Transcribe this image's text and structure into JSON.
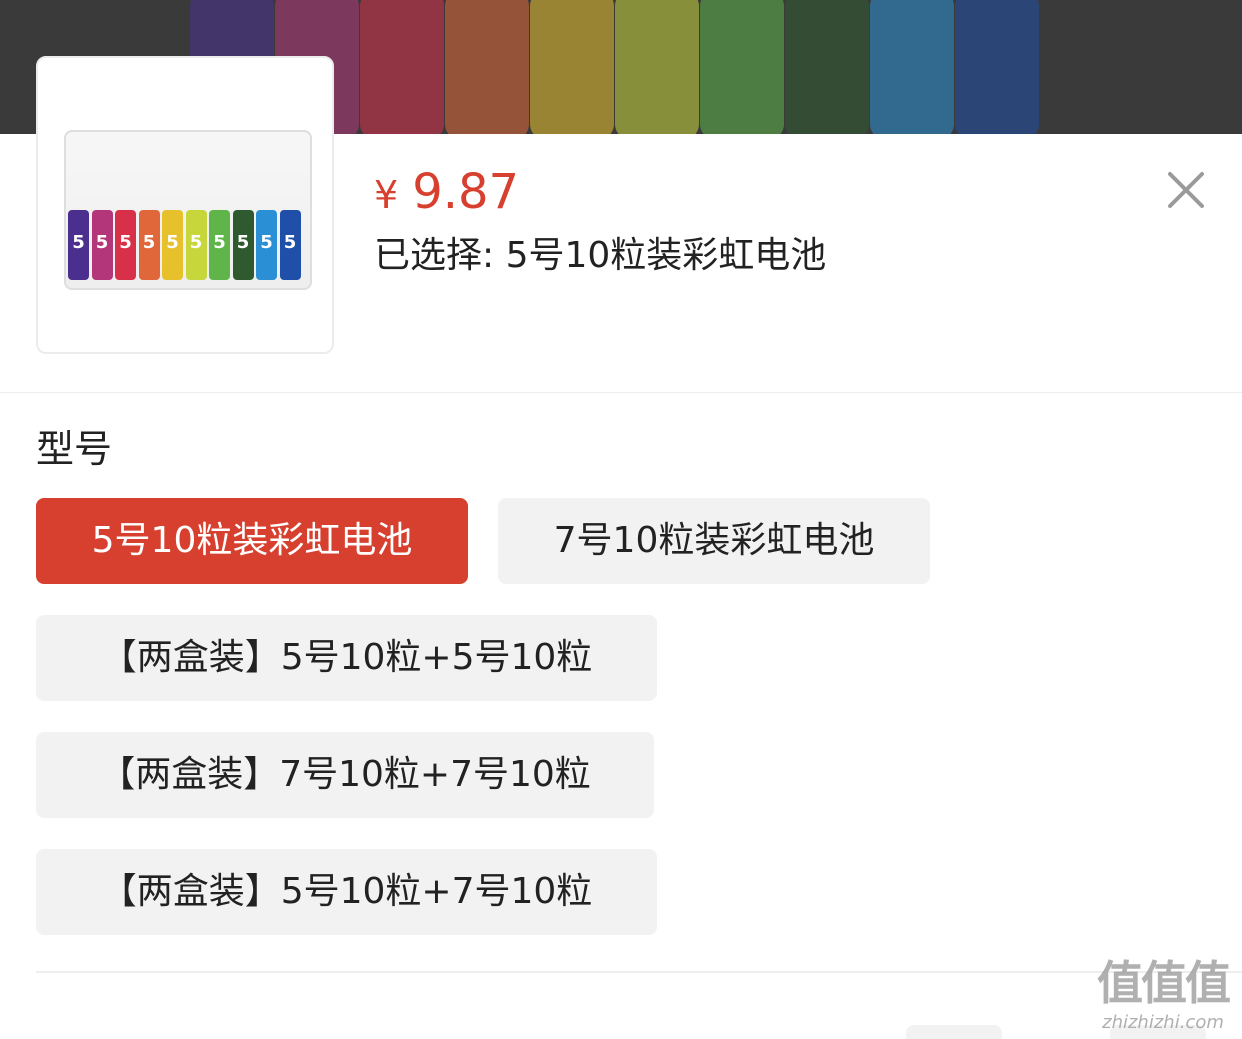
{
  "colors": {
    "accent": "#d7402f",
    "option_bg": "#f2f2f2",
    "backdrop": "#3a3a3a",
    "battery_colors": [
      "#4b2f8f",
      "#b4367a",
      "#d9304a",
      "#e0673a",
      "#e6c12c",
      "#c7d63a",
      "#5fb54a",
      "#2f5a2f",
      "#2b8fd6",
      "#1f4fa8"
    ]
  },
  "product": {
    "price_currency": "¥",
    "price_value": "9.87",
    "selected_text": "已选择: 5号10粒装彩虹电池",
    "battery_digit": "5"
  },
  "variant": {
    "title": "型号",
    "options": [
      {
        "label": "5号10粒装彩虹电池",
        "selected": true
      },
      {
        "label": "7号10粒装彩虹电池",
        "selected": false
      },
      {
        "label": "【两盒装】5号10粒+5号10粒",
        "selected": false
      },
      {
        "label": "【两盒装】7号10粒+7号10粒",
        "selected": false
      },
      {
        "label": "【两盒装】5号10粒+7号10粒",
        "selected": false
      }
    ]
  },
  "watermark": {
    "logo_text": "值值值",
    "url_text": "zhizhizhi.com"
  },
  "icons": {
    "close": "close-icon"
  }
}
